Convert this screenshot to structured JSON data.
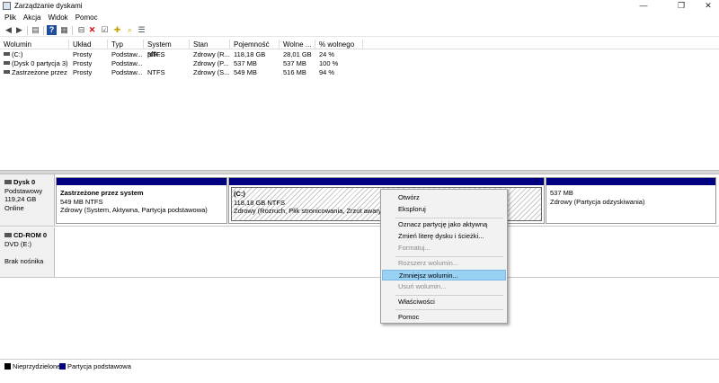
{
  "window": {
    "title": "Zarządzanie dyskami",
    "controls": [
      "—",
      "❐",
      "✕"
    ]
  },
  "menu": [
    "Plik",
    "Akcja",
    "Widok",
    "Pomoc"
  ],
  "toolbar": {
    "icons": [
      "back-arrow-icon",
      "forward-arrow-icon",
      "console-tree-icon",
      "help-icon",
      "properties-icon",
      "connect-icon",
      "delete-icon",
      "check-icon",
      "new-file-icon",
      "search-icon",
      "list-view-icon"
    ],
    "delete_color": "#d40000"
  },
  "volume_table": {
    "columns": [
      "Wolumin",
      "Układ",
      "Typ",
      "System plik...",
      "Stan",
      "Pojemność",
      "Wolne ...",
      "% wolnego"
    ],
    "rows": [
      [
        "(C:)",
        "Prosty",
        "Podstaw...",
        "NTFS",
        "Zdrowy (R...",
        "118,18 GB",
        "28,01 GB",
        "24 %"
      ],
      [
        "(Dysk 0 partycja 3)",
        "Prosty",
        "Podstaw...",
        "",
        "Zdrowy (P...",
        "537 MB",
        "537 MB",
        "100 %"
      ],
      [
        "Zastrzeżone przez ...",
        "Prosty",
        "Podstaw...",
        "NTFS",
        "Zdrowy (S...",
        "549 MB",
        "516 MB",
        "94 %"
      ]
    ]
  },
  "disks": [
    {
      "name": "Dysk 0",
      "type": "Podstawowy",
      "size": "119,24 GB",
      "status": "Online",
      "partitions": [
        {
          "title": "Zastrzeżone przez system",
          "line1": "549 MB NTFS",
          "line2": "Zdrowy (System, Aktywna, Partycja podstawowa)"
        },
        {
          "title": "(C:)",
          "line1": "118,18 GB NTFS",
          "line2": "Zdrowy (Rozruch, Plik stronicowania, Zrzut awaryjny, P"
        },
        {
          "title": "",
          "line1": "537 MB",
          "line2": "Zdrowy (Partycja odzyskiwania)"
        }
      ]
    },
    {
      "name": "CD-ROM 0",
      "type": "DVD (E:)",
      "size": "",
      "status": "Brak nośnika"
    }
  ],
  "context_menu": {
    "items": [
      {
        "label": "Otwórz",
        "disabled": false
      },
      {
        "label": "Eksploruj",
        "disabled": false
      },
      {
        "label": "Oznacz partycję jako aktywną",
        "disabled": false
      },
      {
        "label": "Zmień literę dysku i ścieżki...",
        "disabled": false
      },
      {
        "label": "Formatuj...",
        "disabled": true
      },
      {
        "label": "Rozszerz wolumin...",
        "disabled": true
      },
      {
        "label": "Zmniejsz wolumin...",
        "disabled": false,
        "highlighted": true
      },
      {
        "label": "Usuń wolumin...",
        "disabled": true
      },
      {
        "label": "Właściwości",
        "disabled": false
      },
      {
        "label": "Pomoc",
        "disabled": false
      }
    ],
    "highlight_color": "#99d1f5"
  },
  "legend": [
    {
      "label": "Nieprzydzielone",
      "color": "#000000"
    },
    {
      "label": "Partycja podstawowa",
      "color": "#000080"
    }
  ]
}
